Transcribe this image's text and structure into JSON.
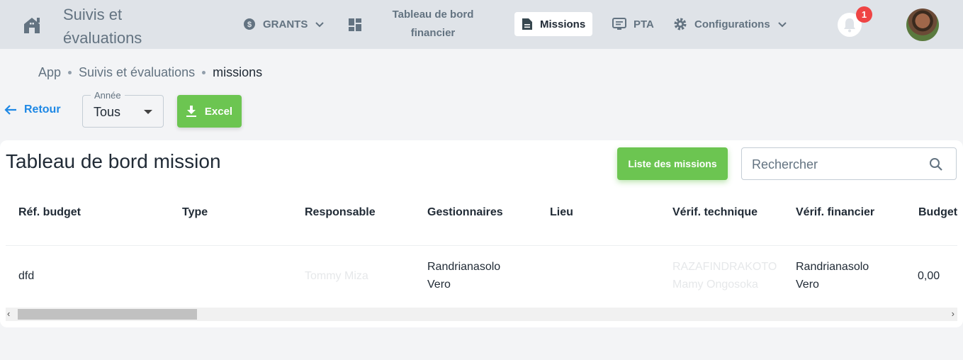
{
  "header": {
    "app_title": "Suivis et évaluations",
    "nav": {
      "grants": "GRANTS",
      "dashboard_financier": "Tableau de bord financier",
      "missions": "Missions",
      "pta": "PTA",
      "configurations": "Configurations"
    },
    "notifications_count": "1"
  },
  "breadcrumb": {
    "items": [
      "App",
      "Suivis et évaluations",
      "missions"
    ]
  },
  "toolbar": {
    "back_label": "Retour",
    "year_label": "Année",
    "year_value": "Tous",
    "excel_label": "Excel"
  },
  "card": {
    "title": "Tableau de bord mission",
    "list_button": "Liste des missions",
    "search_placeholder": "Rechercher"
  },
  "table": {
    "columns": [
      "Réf. budget",
      "Type",
      "Responsable",
      "Gestionnaires",
      "Lieu",
      "Vérif. technique",
      "Vérif. financier",
      "Budget"
    ],
    "rows": [
      {
        "ref_budget": "dfd",
        "type": "",
        "responsable": "Tommy Miza",
        "gestionnaires_1": "Randrianasolo",
        "gestionnaires_2": "Vero",
        "lieu": "",
        "verif_technique_1": "RAZAFINDRAKOTO",
        "verif_technique_2": "Mamy Ongosoka",
        "verif_financier_1": "Randrianasolo",
        "verif_financier_2": "Vero",
        "budget": "0,00"
      }
    ]
  },
  "colors": {
    "accent_green": "#6cc551",
    "link_blue": "#1e88e5",
    "badge_red": "#ef4444",
    "topbar_bg": "#dfe3e8"
  }
}
